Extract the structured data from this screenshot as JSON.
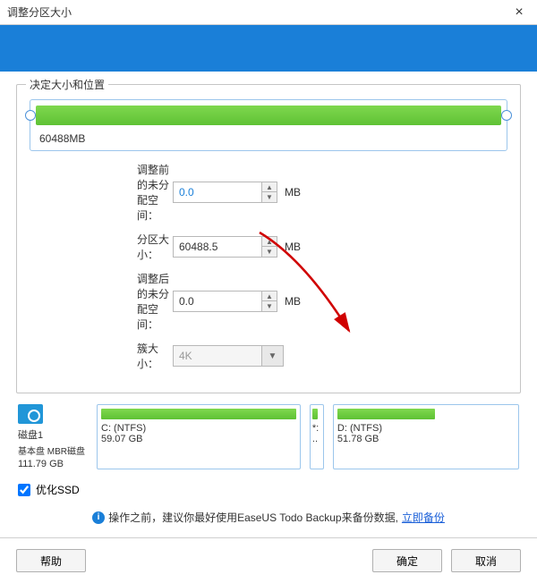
{
  "window": {
    "title": "调整分区大小"
  },
  "group": {
    "title": "决定大小和位置",
    "sizeLabel": "60488MB"
  },
  "form": {
    "beforeLabel": "调整前的未分配空间：",
    "beforeValue": "0.0",
    "sizeLabel": "分区大小：",
    "sizeValue": "60488.5",
    "afterLabel": "调整后的未分配空间：",
    "afterValue": "0.0",
    "clusterLabel": "簇大小：",
    "clusterValue": "4K",
    "unit": "MB"
  },
  "disk": {
    "name": "磁盘1",
    "type": "基本盘 MBR磁盘",
    "total": "111.79 GB"
  },
  "partitions": {
    "c": {
      "name": "C: (NTFS)",
      "size": "59.07 GB"
    },
    "mid": {
      "name": "*:",
      "size": ".."
    },
    "d": {
      "name": "D: (NTFS)",
      "size": "51.78 GB"
    }
  },
  "optimize": "优化SSD",
  "hint": {
    "text": "操作之前，建议你最好使用EaseUS Todo Backup来备份数据,",
    "link": "立即备份"
  },
  "buttons": {
    "help": "帮助",
    "ok": "确定",
    "cancel": "取消"
  }
}
